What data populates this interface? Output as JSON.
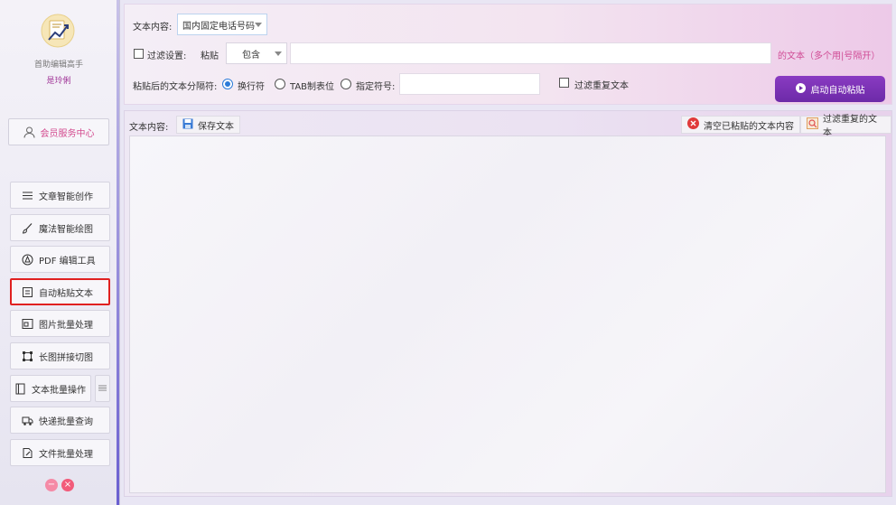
{
  "sidebar": {
    "app_name": "首助编辑高手",
    "user": "是玲俐",
    "member_button": "会员服务中心",
    "items": [
      {
        "label": "文章智能创作",
        "icon": "list-icon"
      },
      {
        "label": "魔法智能绘图",
        "icon": "brush-icon"
      },
      {
        "label": "PDF 编辑工具",
        "icon": "pdf-icon"
      },
      {
        "label": "自动粘贴文本",
        "icon": "clipboard-icon",
        "active": true
      },
      {
        "label": "图片批量处理",
        "icon": "image-icon"
      },
      {
        "label": "长图拼接切图",
        "icon": "crop-icon"
      },
      {
        "label": "文本批量操作",
        "icon": "book-icon"
      },
      {
        "label": "快递批量查询",
        "icon": "truck-icon"
      },
      {
        "label": "文件批量处理",
        "icon": "file-edit-icon"
      }
    ],
    "extra_icon": "menu-lines-icon",
    "window_controls": {
      "minimize": "minimize-icon",
      "close": "close-icon"
    }
  },
  "top": {
    "content_label": "文本内容:",
    "content_select": "国内固定电话号码",
    "filter_label": "过滤设置:",
    "paste_label": "粘贴",
    "contains_select": "包含",
    "filter_input": "",
    "filter_hint": "的文本（多个用|号隔开）",
    "separator_label": "粘贴后的文本分隔符:",
    "radio_newline": "换行符",
    "radio_tab": "TAB制表位",
    "radio_custom": "指定符号:",
    "custom_input": "",
    "dedupe_label": "过滤重复文本",
    "start_button": "启动自动粘贴"
  },
  "bottom": {
    "content_label": "文本内容:",
    "save_button": "保存文本",
    "clear_button": "清空已粘贴的文本内容",
    "filter_dup_button": "过滤重复的文本",
    "text_value": ""
  },
  "colors": {
    "accent_purple": "#7a30b5",
    "hint_pink": "#d04b95",
    "active_border": "#e02020",
    "radio_blue": "#2b7bd8"
  }
}
